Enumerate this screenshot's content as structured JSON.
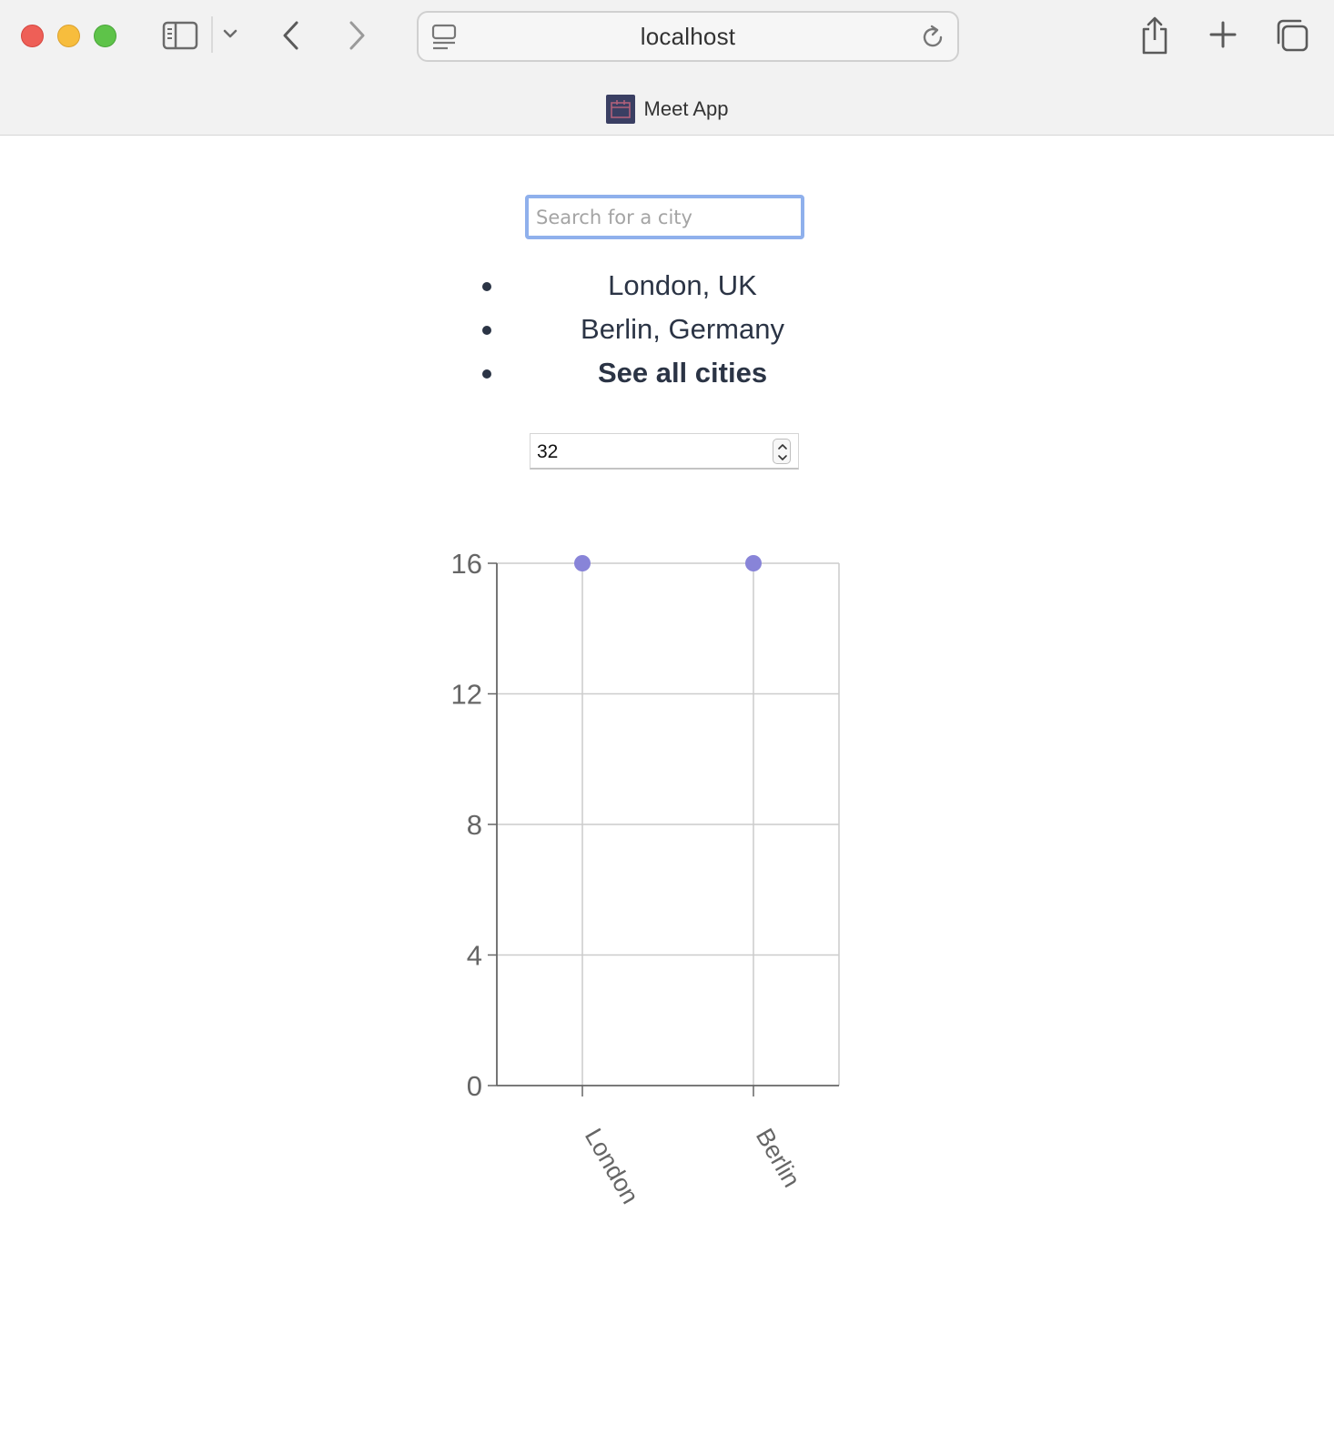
{
  "browser": {
    "url": "localhost",
    "tab_title": "Meet App",
    "icons": [
      "sidebar-icon",
      "chevron-down-icon",
      "back-icon",
      "forward-icon",
      "site-settings-icon",
      "reload-icon",
      "share-icon",
      "new-tab-icon",
      "tabs-overview-icon"
    ]
  },
  "search": {
    "placeholder": "Search for a city",
    "value": ""
  },
  "suggestions": [
    {
      "label": "London, UK"
    },
    {
      "label": "Berlin, Germany"
    },
    {
      "label": "See all cities"
    }
  ],
  "event_count": {
    "value": "32"
  },
  "colors": {
    "point": "#8884d8",
    "focus_ring": "#8fb0ec",
    "text": "#2b3445"
  },
  "chart_data": {
    "type": "scatter",
    "categories": [
      "London",
      "Berlin"
    ],
    "values": [
      16,
      16
    ],
    "ylim": [
      0,
      16
    ],
    "yticks": [
      "0",
      "4",
      "8",
      "12",
      "16"
    ],
    "grid": true
  }
}
